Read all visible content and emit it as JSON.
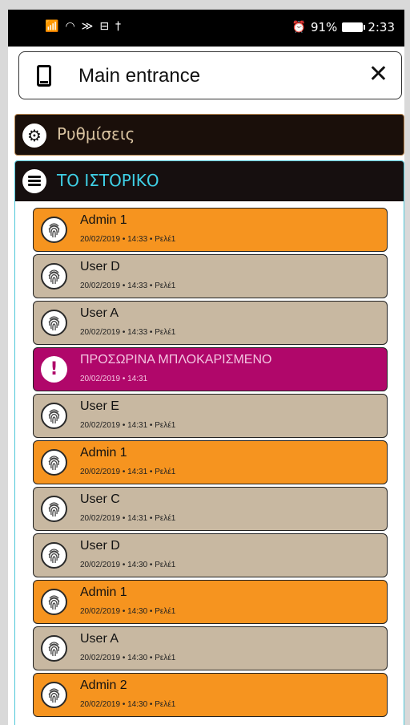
{
  "status_bar": {
    "left_icons": [
      "signal-icon",
      "wifi-icon",
      "hotspot-icon",
      "car-icon",
      "antenna-icon"
    ],
    "alarm_icon": "alarm-icon",
    "battery_percent": "91%",
    "time": "2:33"
  },
  "header": {
    "title": "Main entrance",
    "close_label": "✕"
  },
  "settings": {
    "label": "Ρυθμίσεις"
  },
  "history": {
    "label": "ΤΟ ΙΣΤΟΡΙΚΟ",
    "entries": [
      {
        "name": "Admin 1",
        "detail": "20/02/2019 • 14:33 • Ρελέ1",
        "kind": "admin"
      },
      {
        "name": "User D",
        "detail": "20/02/2019 • 14:33 • Ρελέ1",
        "kind": "user"
      },
      {
        "name": "User A",
        "detail": "20/02/2019 • 14:33 • Ρελέ1",
        "kind": "user"
      },
      {
        "name": "ΠΡΟΣΩΡΙΝΑ ΜΠΛΟΚΑΡΙΣΜΕΝΟ",
        "detail": "20/02/2019 • 14:31",
        "kind": "block"
      },
      {
        "name": "User E",
        "detail": "20/02/2019 • 14:31 • Ρελέ1",
        "kind": "user"
      },
      {
        "name": "Admin 1",
        "detail": "20/02/2019 • 14:31 • Ρελέ1",
        "kind": "admin"
      },
      {
        "name": "User C",
        "detail": "20/02/2019 • 14:31 • Ρελέ1",
        "kind": "user"
      },
      {
        "name": "User D",
        "detail": "20/02/2019 • 14:30 • Ρελέ1",
        "kind": "user"
      },
      {
        "name": "Admin 1",
        "detail": "20/02/2019 • 14:30 • Ρελέ1",
        "kind": "admin"
      },
      {
        "name": "User A",
        "detail": "20/02/2019 • 14:30 • Ρελέ1",
        "kind": "user"
      },
      {
        "name": "Admin 2",
        "detail": "20/02/2019 • 14:30 • Ρελέ1",
        "kind": "admin"
      }
    ]
  },
  "colors": {
    "admin": "#f6941f",
    "user": "#c8b8a1",
    "blocked": "#b0076a",
    "accent": "#3fd0e6"
  }
}
